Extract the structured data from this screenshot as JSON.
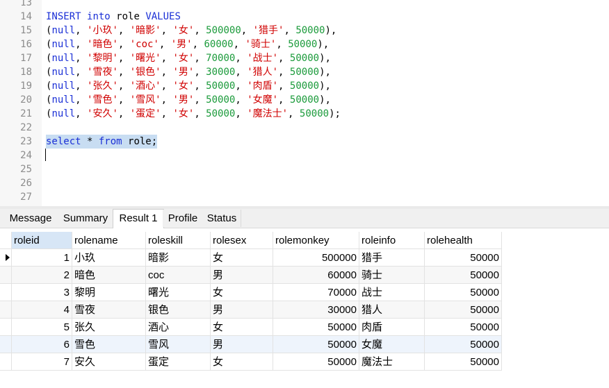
{
  "editor": {
    "lines": [
      {
        "n": "13",
        "t": []
      },
      {
        "n": "14",
        "t": [
          [
            "kw",
            "INSERT"
          ],
          [
            "pl",
            " "
          ],
          [
            "kw",
            "into"
          ],
          [
            "pl",
            " role "
          ],
          [
            "kw",
            "VALUES"
          ]
        ]
      },
      {
        "n": "15",
        "t": [
          [
            "pl",
            "("
          ],
          [
            "kw",
            "null"
          ],
          [
            "pl",
            ", "
          ],
          [
            "str",
            "'小玖'"
          ],
          [
            "pl",
            ", "
          ],
          [
            "str",
            "'暗影'"
          ],
          [
            "pl",
            ", "
          ],
          [
            "str",
            "'女'"
          ],
          [
            "pl",
            ", "
          ],
          [
            "num",
            "500000"
          ],
          [
            "pl",
            ", "
          ],
          [
            "str",
            "'猎手'"
          ],
          [
            "pl",
            ", "
          ],
          [
            "num",
            "50000"
          ],
          [
            "pl",
            "),"
          ]
        ]
      },
      {
        "n": "16",
        "t": [
          [
            "pl",
            "("
          ],
          [
            "kw",
            "null"
          ],
          [
            "pl",
            ", "
          ],
          [
            "str",
            "'暗色'"
          ],
          [
            "pl",
            ", "
          ],
          [
            "str",
            "'coc'"
          ],
          [
            "pl",
            ", "
          ],
          [
            "str",
            "'男'"
          ],
          [
            "pl",
            ", "
          ],
          [
            "num",
            "60000"
          ],
          [
            "pl",
            ", "
          ],
          [
            "str",
            "'骑士'"
          ],
          [
            "pl",
            ", "
          ],
          [
            "num",
            "50000"
          ],
          [
            "pl",
            "),"
          ]
        ]
      },
      {
        "n": "17",
        "t": [
          [
            "pl",
            "("
          ],
          [
            "kw",
            "null"
          ],
          [
            "pl",
            ", "
          ],
          [
            "str",
            "'黎明'"
          ],
          [
            "pl",
            ", "
          ],
          [
            "str",
            "'曙光'"
          ],
          [
            "pl",
            ", "
          ],
          [
            "str",
            "'女'"
          ],
          [
            "pl",
            ", "
          ],
          [
            "num",
            "70000"
          ],
          [
            "pl",
            ", "
          ],
          [
            "str",
            "'战士'"
          ],
          [
            "pl",
            ", "
          ],
          [
            "num",
            "50000"
          ],
          [
            "pl",
            "),"
          ]
        ]
      },
      {
        "n": "18",
        "t": [
          [
            "pl",
            "("
          ],
          [
            "kw",
            "null"
          ],
          [
            "pl",
            ", "
          ],
          [
            "str",
            "'雪夜'"
          ],
          [
            "pl",
            ", "
          ],
          [
            "str",
            "'银色'"
          ],
          [
            "pl",
            ", "
          ],
          [
            "str",
            "'男'"
          ],
          [
            "pl",
            ", "
          ],
          [
            "num",
            "30000"
          ],
          [
            "pl",
            ", "
          ],
          [
            "str",
            "'猎人'"
          ],
          [
            "pl",
            ", "
          ],
          [
            "num",
            "50000"
          ],
          [
            "pl",
            "),"
          ]
        ]
      },
      {
        "n": "19",
        "t": [
          [
            "pl",
            "("
          ],
          [
            "kw",
            "null"
          ],
          [
            "pl",
            ", "
          ],
          [
            "str",
            "'张久'"
          ],
          [
            "pl",
            ", "
          ],
          [
            "str",
            "'酒心'"
          ],
          [
            "pl",
            ", "
          ],
          [
            "str",
            "'女'"
          ],
          [
            "pl",
            ", "
          ],
          [
            "num",
            "50000"
          ],
          [
            "pl",
            ", "
          ],
          [
            "str",
            "'肉盾'"
          ],
          [
            "pl",
            ", "
          ],
          [
            "num",
            "50000"
          ],
          [
            "pl",
            "),"
          ]
        ]
      },
      {
        "n": "20",
        "t": [
          [
            "pl",
            "("
          ],
          [
            "kw",
            "null"
          ],
          [
            "pl",
            ", "
          ],
          [
            "str",
            "'雪色'"
          ],
          [
            "pl",
            ", "
          ],
          [
            "str",
            "'雪风'"
          ],
          [
            "pl",
            ", "
          ],
          [
            "str",
            "'男'"
          ],
          [
            "pl",
            ", "
          ],
          [
            "num",
            "50000"
          ],
          [
            "pl",
            ", "
          ],
          [
            "str",
            "'女魔'"
          ],
          [
            "pl",
            ", "
          ],
          [
            "num",
            "50000"
          ],
          [
            "pl",
            "),"
          ]
        ]
      },
      {
        "n": "21",
        "t": [
          [
            "pl",
            "("
          ],
          [
            "kw",
            "null"
          ],
          [
            "pl",
            ", "
          ],
          [
            "str",
            "'安久'"
          ],
          [
            "pl",
            ", "
          ],
          [
            "str",
            "'蛋定'"
          ],
          [
            "pl",
            ", "
          ],
          [
            "str",
            "'女'"
          ],
          [
            "pl",
            ", "
          ],
          [
            "num",
            "50000"
          ],
          [
            "pl",
            ", "
          ],
          [
            "str",
            "'魔法士'"
          ],
          [
            "pl",
            ", "
          ],
          [
            "num",
            "50000"
          ],
          [
            "pl",
            ");"
          ]
        ]
      },
      {
        "n": "22",
        "t": []
      },
      {
        "n": "23",
        "t": [
          [
            "kw",
            "select"
          ],
          [
            "pl",
            " * "
          ],
          [
            "kw",
            "from"
          ],
          [
            "pl",
            " role;"
          ]
        ],
        "selected": true
      },
      {
        "n": "24",
        "t": []
      },
      {
        "n": "25",
        "t": []
      },
      {
        "n": "26",
        "t": []
      },
      {
        "n": "27",
        "t": []
      }
    ]
  },
  "tabs": [
    {
      "label": "Message"
    },
    {
      "label": "Summary"
    },
    {
      "label": "Result 1",
      "active": true
    },
    {
      "label": "Profile"
    },
    {
      "label": "Status"
    }
  ],
  "grid": {
    "columns": [
      "roleid",
      "rolename",
      "roleskill",
      "rolesex",
      "rolemonkey",
      "roleinfo",
      "rolehealth"
    ],
    "rows": [
      [
        "1",
        "小玖",
        "暗影",
        "女",
        "500000",
        "猎手",
        "50000"
      ],
      [
        "2",
        "暗色",
        "coc",
        "男",
        "60000",
        "骑士",
        "50000"
      ],
      [
        "3",
        "黎明",
        "曙光",
        "女",
        "70000",
        "战士",
        "50000"
      ],
      [
        "4",
        "雪夜",
        "银色",
        "男",
        "30000",
        "猎人",
        "50000"
      ],
      [
        "5",
        "张久",
        "酒心",
        "女",
        "50000",
        "肉盾",
        "50000"
      ],
      [
        "6",
        "雪色",
        "雪风",
        "男",
        "50000",
        "女魔",
        "50000"
      ],
      [
        "7",
        "安久",
        "蛋定",
        "女",
        "50000",
        "魔法士",
        "50000"
      ]
    ],
    "current_row": 0,
    "hover_row": 5
  },
  "colors": {
    "keyword": "#1a2fd6",
    "string": "#d00000",
    "number": "#1a9a3a",
    "selection": "#c8ddf2",
    "header_active": "#d7e6f6"
  }
}
